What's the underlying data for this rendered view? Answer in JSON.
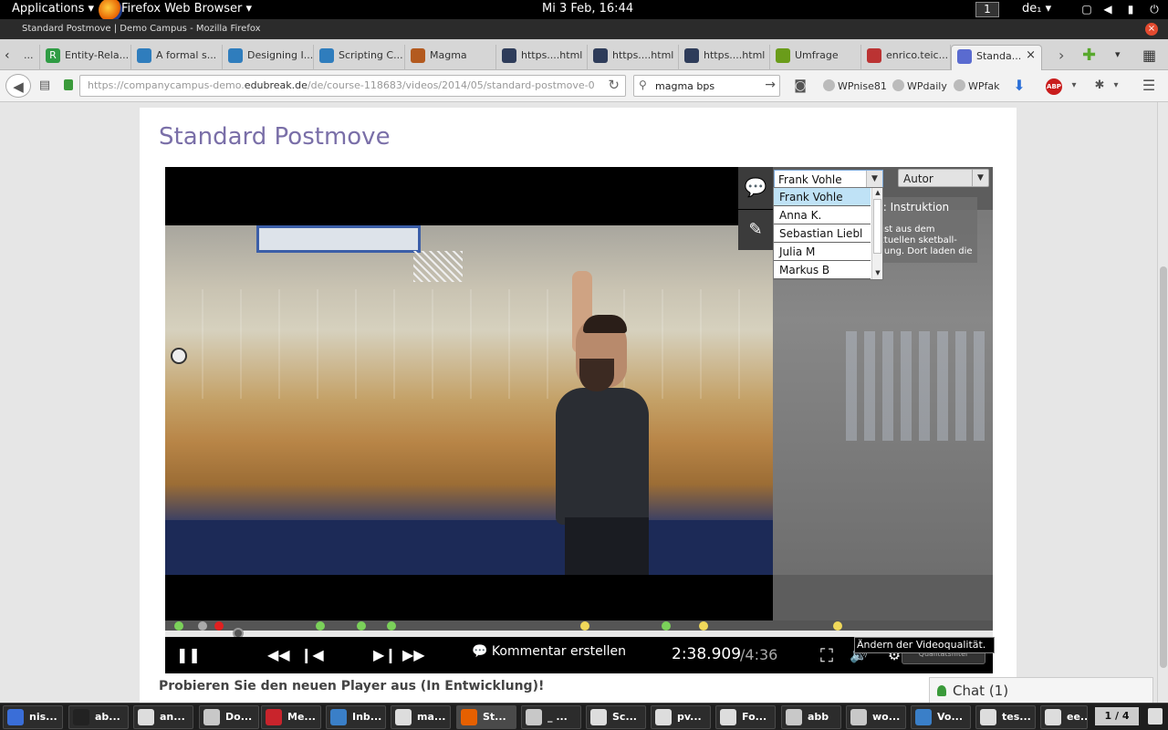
{
  "topbar": {
    "applications": "Applications ▾",
    "app_name": "Firefox Web Browser ▾",
    "clock": "Mi  3 Feb, 16:44",
    "workspace": "1",
    "keyboard": "de₁ ▾"
  },
  "window": {
    "title": "Standard Postmove | Demo Campus - Mozilla Firefox",
    "close": "×"
  },
  "tabs": [
    {
      "label": "...",
      "icon": "overflow",
      "color": "#888888"
    },
    {
      "label": "Entity-Rela...",
      "icon": "R",
      "color": "#2f9c44"
    },
    {
      "label": "A formal s...",
      "icon": "stackexchange",
      "color": "#2f7dbd"
    },
    {
      "label": "Designing I...",
      "icon": "stackexchange",
      "color": "#2f7dbd"
    },
    {
      "label": "Scripting C...",
      "icon": "stackexchange",
      "color": "#2f7dbd"
    },
    {
      "label": "Magma",
      "icon": "magma",
      "color": "#b35a1f"
    },
    {
      "label": "https....html",
      "icon": "doc",
      "color": "#2e3c5a"
    },
    {
      "label": "https....html",
      "icon": "doc",
      "color": "#2e3c5a"
    },
    {
      "label": "https....html",
      "icon": "doc",
      "color": "#2e3c5a"
    },
    {
      "label": "Umfrage",
      "icon": "umfrage",
      "color": "#6a9c1a"
    },
    {
      "label": "enrico.teic...",
      "icon": "page",
      "color": "#b33"
    },
    {
      "label": "Standa...",
      "icon": "edubreak",
      "color": "#5a6bd0",
      "active": true
    }
  ],
  "tab_close": "×",
  "tab_new": "✚",
  "nav": {
    "back": "◀",
    "url_prefix": "https://companycampus-demo.",
    "url_host": "edubreak.de",
    "url_path": "/de/course-118683/videos/2014/05/standard-postmove-0",
    "search_value": "magma bps",
    "bookmarks": [
      "WPnise81",
      "WPdaily",
      "WPfak"
    ],
    "abp": "ABP"
  },
  "page": {
    "title": "Standard Postmove",
    "promo": "Probieren Sie den neuen Player aus (In Entwicklung)!",
    "chat": "Chat (1)"
  },
  "player": {
    "user_select": "Frank Vohle",
    "author_select": "Autor",
    "users": [
      "Frank Vohle",
      "Anna K.",
      "Sebastian Liebl",
      "Julia M",
      "Markus B"
    ],
    "note_title": "le: Instruktion",
    "note_body": "o ist aus dem aktuellen sketball-ildung. Dort laden die",
    "komment": "Kommentar erstellen",
    "time": "2:38.909",
    "duration": "/4:36",
    "tooltip": "Ändern der Videoqualität.",
    "quality_label": "Qualitätsfilter",
    "progress": 0.088,
    "markers": [
      {
        "pos": 0.017,
        "color": "#7bd15a"
      },
      {
        "pos": 0.045,
        "color": "#aaaaaa"
      },
      {
        "pos": 0.065,
        "color": "#e02020"
      },
      {
        "pos": 0.187,
        "color": "#7bd15a"
      },
      {
        "pos": 0.237,
        "color": "#7bd15a"
      },
      {
        "pos": 0.273,
        "color": "#7bd15a"
      },
      {
        "pos": 0.507,
        "color": "#f0d85a"
      },
      {
        "pos": 0.605,
        "color": "#7bd15a"
      },
      {
        "pos": 0.65,
        "color": "#f0d85a"
      },
      {
        "pos": 0.813,
        "color": "#f0d85a"
      }
    ]
  },
  "taskbar": {
    "items": [
      {
        "label": "nis...",
        "color": "#3a6ed8"
      },
      {
        "label": "ab...",
        "color": "#222222"
      },
      {
        "label": "an...",
        "color": "#dddddd"
      },
      {
        "label": "Do...",
        "color": "#c8c8c8"
      },
      {
        "label": "Me...",
        "color": "#c9242c"
      },
      {
        "label": "Inb...",
        "color": "#3a7fc8"
      },
      {
        "label": "ma...",
        "color": "#dddddd"
      },
      {
        "label": "St...",
        "color": "#e66000",
        "active": true
      },
      {
        "label": "_ ...",
        "color": "#c8c8c8"
      },
      {
        "label": "Sc...",
        "color": "#dddddd"
      },
      {
        "label": "pv...",
        "color": "#dddddd"
      },
      {
        "label": "Fo...",
        "color": "#dddddd"
      },
      {
        "label": "abb",
        "color": "#c8c8c8"
      },
      {
        "label": "wo...",
        "color": "#c8c8c8"
      },
      {
        "label": "Vo...",
        "color": "#3a7fc8"
      },
      {
        "label": "tes...",
        "color": "#dddddd"
      },
      {
        "label": "ee...",
        "color": "#dddddd"
      }
    ],
    "pager": "1 / 4"
  }
}
